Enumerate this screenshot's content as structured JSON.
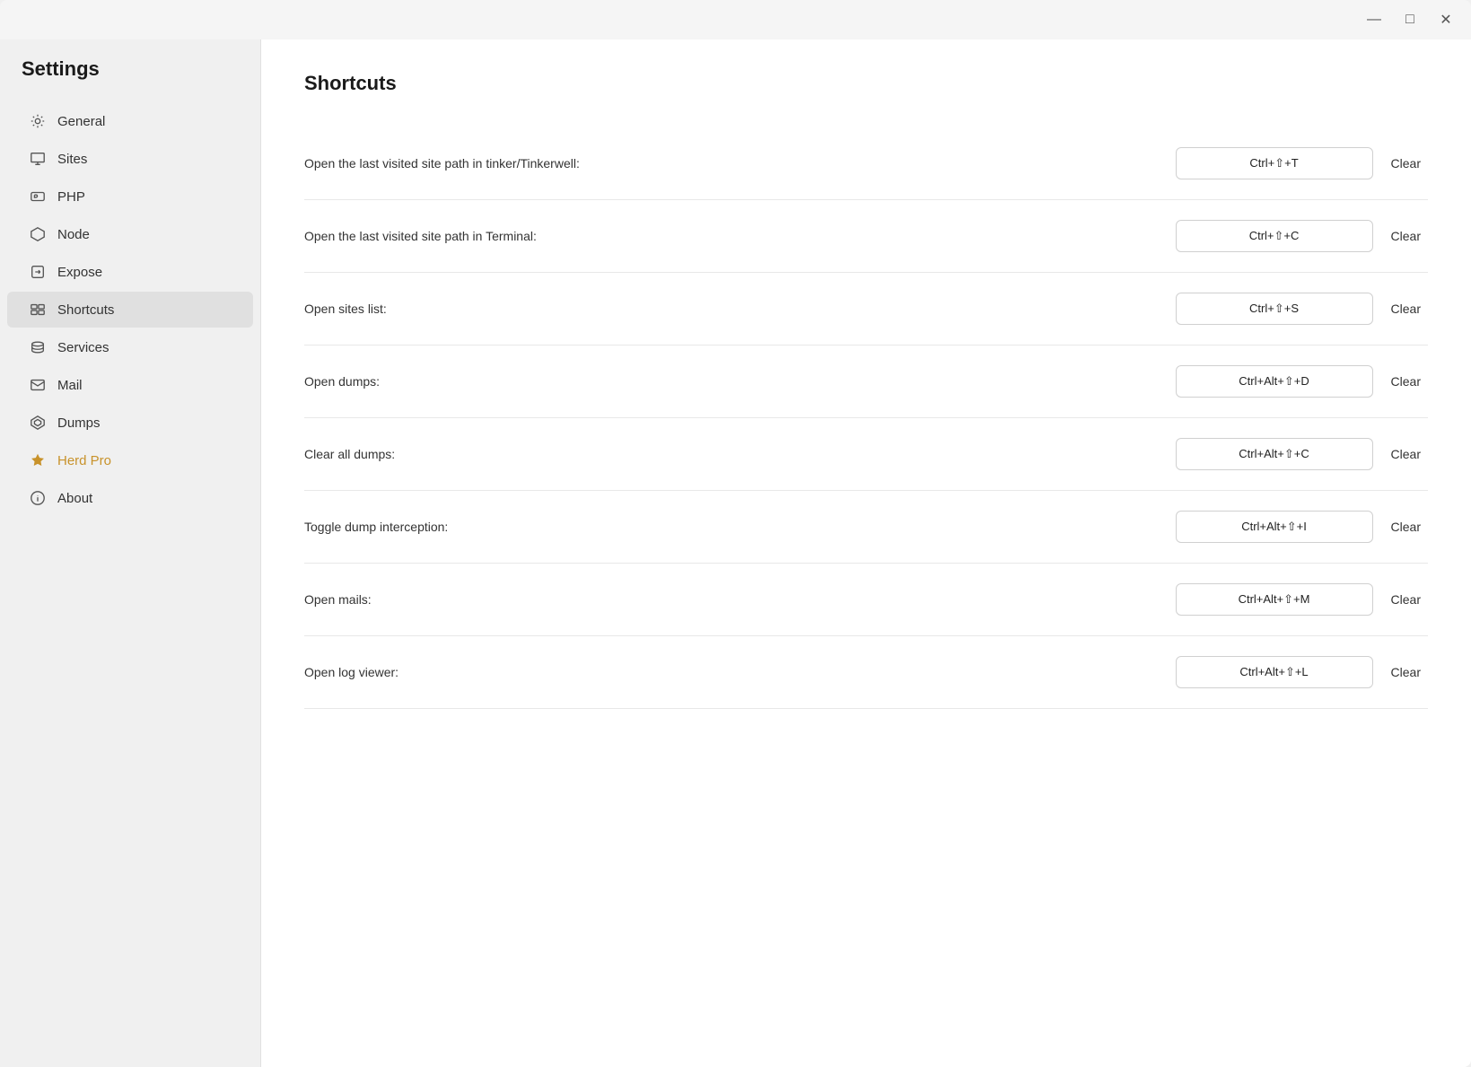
{
  "window": {
    "title": "Settings",
    "title_bar_buttons": {
      "minimize": "—",
      "maximize": "□",
      "close": "✕"
    }
  },
  "sidebar": {
    "title": "Settings",
    "items": [
      {
        "id": "general",
        "label": "General",
        "icon": "gear-icon"
      },
      {
        "id": "sites",
        "label": "Sites",
        "icon": "monitor-icon"
      },
      {
        "id": "php",
        "label": "PHP",
        "icon": "php-icon"
      },
      {
        "id": "node",
        "label": "Node",
        "icon": "node-icon"
      },
      {
        "id": "expose",
        "label": "Expose",
        "icon": "expose-icon"
      },
      {
        "id": "shortcuts",
        "label": "Shortcuts",
        "icon": "shortcuts-icon",
        "active": true
      },
      {
        "id": "services",
        "label": "Services",
        "icon": "services-icon"
      },
      {
        "id": "mail",
        "label": "Mail",
        "icon": "mail-icon"
      },
      {
        "id": "dumps",
        "label": "Dumps",
        "icon": "dumps-icon"
      },
      {
        "id": "herd-pro",
        "label": "Herd Pro",
        "icon": "star-icon",
        "special": "herd-pro"
      },
      {
        "id": "about",
        "label": "About",
        "icon": "info-icon"
      }
    ]
  },
  "content": {
    "title": "Shortcuts",
    "shortcuts": [
      {
        "id": "tinker",
        "label": "Open the last visited site path in tinker/Tinkerwell:",
        "keybinding": "Ctrl+⇧+T",
        "clear_label": "Clear"
      },
      {
        "id": "terminal",
        "label": "Open the last visited site path in Terminal:",
        "keybinding": "Ctrl+⇧+C",
        "clear_label": "Clear"
      },
      {
        "id": "sites-list",
        "label": "Open sites list:",
        "keybinding": "Ctrl+⇧+S",
        "clear_label": "Clear"
      },
      {
        "id": "open-dumps",
        "label": "Open dumps:",
        "keybinding": "Ctrl+Alt+⇧+D",
        "clear_label": "Clear"
      },
      {
        "id": "clear-dumps",
        "label": "Clear all dumps:",
        "keybinding": "Ctrl+Alt+⇧+C",
        "clear_label": "Clear"
      },
      {
        "id": "toggle-interception",
        "label": "Toggle dump interception:",
        "keybinding": "Ctrl+Alt+⇧+I",
        "clear_label": "Clear"
      },
      {
        "id": "open-mails",
        "label": "Open mails:",
        "keybinding": "Ctrl+Alt+⇧+M",
        "clear_label": "Clear"
      },
      {
        "id": "open-log",
        "label": "Open log viewer:",
        "keybinding": "Ctrl+Alt+⇧+L",
        "clear_label": "Clear"
      }
    ]
  }
}
